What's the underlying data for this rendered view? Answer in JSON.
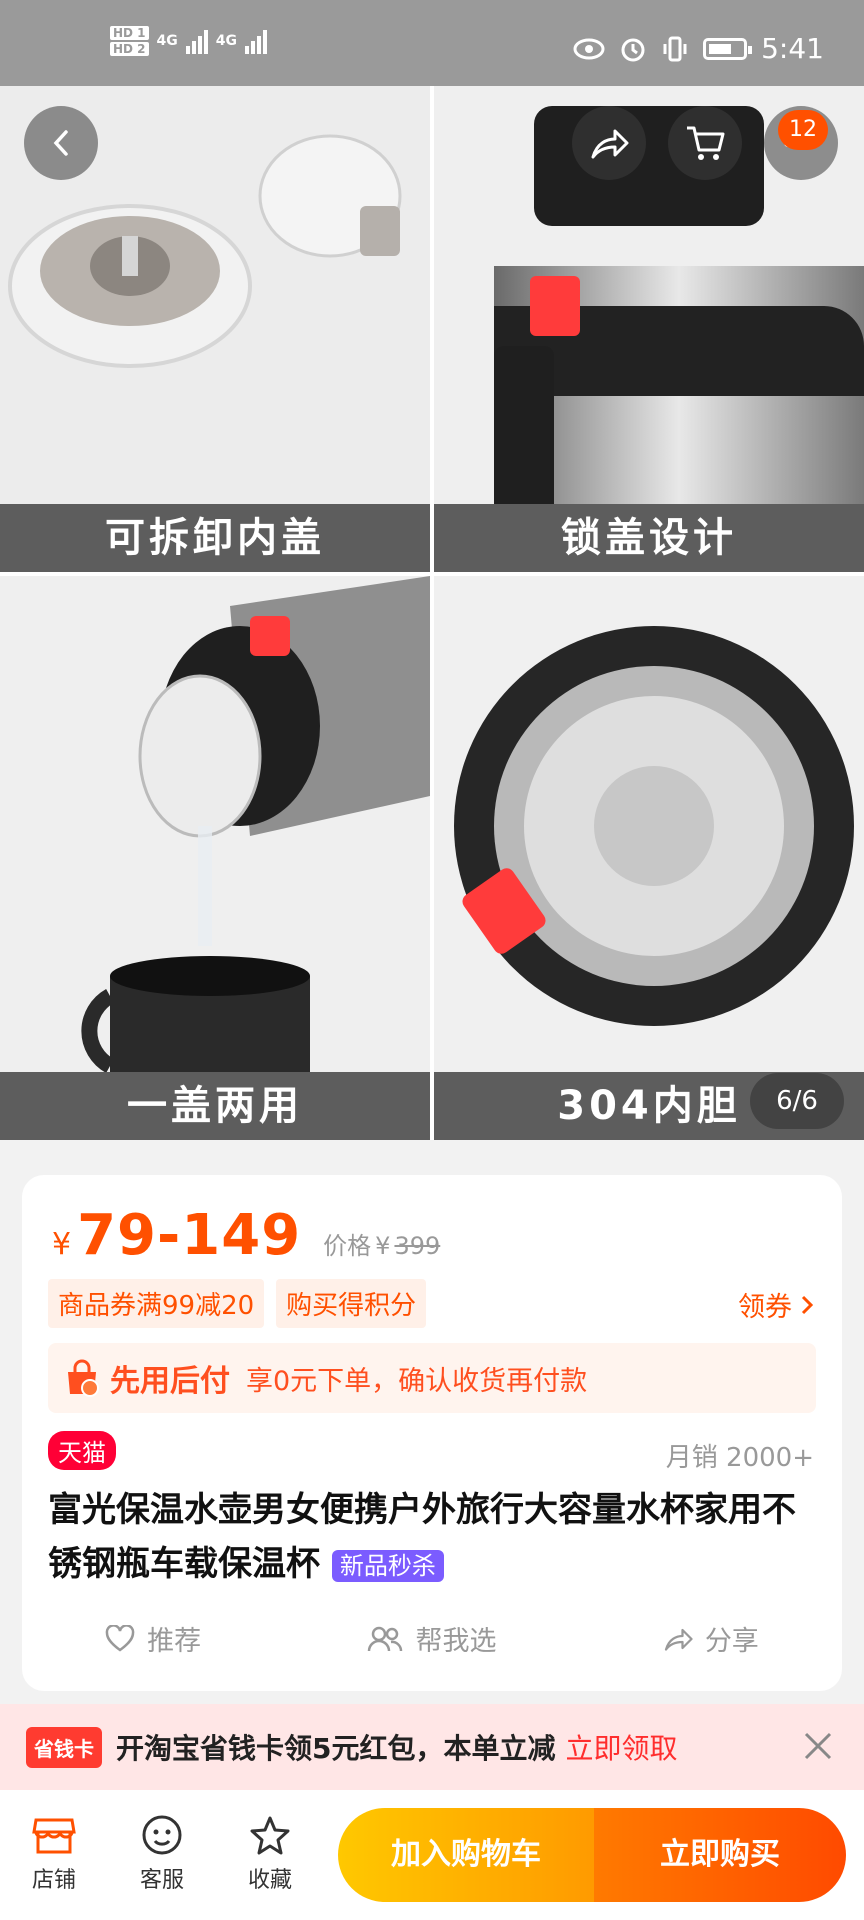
{
  "status_bar": {
    "hd1": "HD 1",
    "hd2": "HD 2",
    "net1": "4G",
    "net2": "4G",
    "time": "5:41"
  },
  "gallery": {
    "captions": [
      "可拆卸内盖",
      "锁盖设计",
      "一盖两用",
      "304内胆"
    ],
    "page_indicator": "6/6",
    "cart_badge": "12"
  },
  "price": {
    "currency": "¥",
    "range": "79-149",
    "orig_label": "价格",
    "orig_currency": "¥",
    "orig_value": "399"
  },
  "coupons": [
    "商品券满99减20",
    "购买得积分"
  ],
  "coupon_link": "领券",
  "pay_later": {
    "title": "先用后付",
    "desc": "享0元下单，确认收货再付款"
  },
  "tmall_badge": "天猫",
  "sales": "月销 2000+",
  "product_title": "富光保温水壶男女便携户外旅行大容量水杯家用不锈钢瓶车载保温杯",
  "new_tag": "新品秒杀",
  "actions": [
    "推荐",
    "帮我选",
    "分享"
  ],
  "promo": {
    "badge": "省钱卡",
    "text": "开淘宝省钱卡领5元红包，本单立减",
    "link": "立即领取"
  },
  "bottom": {
    "shop": "店铺",
    "service": "客服",
    "favorite": "收藏",
    "add_cart": "加入购物车",
    "buy_now": "立即购买"
  },
  "colors": {
    "accent": "#ff5000",
    "tmall": "#ff0036",
    "new_tag": "#7b5cff"
  }
}
